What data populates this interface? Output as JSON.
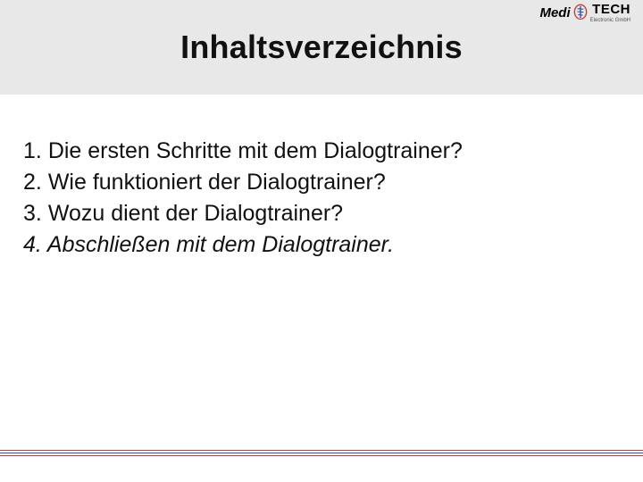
{
  "logo": {
    "brand_left": "Medi",
    "brand_right": "TECH",
    "subtext": "Electronic GmbH"
  },
  "header": {
    "title": "Inhaltsverzeichnis"
  },
  "toc": {
    "items": [
      {
        "num": "1.",
        "text": "Die ersten Schritte mit dem Dialogtrainer?"
      },
      {
        "num": "2.",
        "text": "Wie funktioniert der Dialogtrainer?"
      },
      {
        "num": "3.",
        "text": "Wozu dient der Dialogtrainer?"
      },
      {
        "num": "4.",
        "text": "Abschließen mit dem Dialogtrainer."
      }
    ]
  },
  "colors": {
    "accent_red": "#c53a33",
    "accent_blue": "#2e4fa3"
  }
}
